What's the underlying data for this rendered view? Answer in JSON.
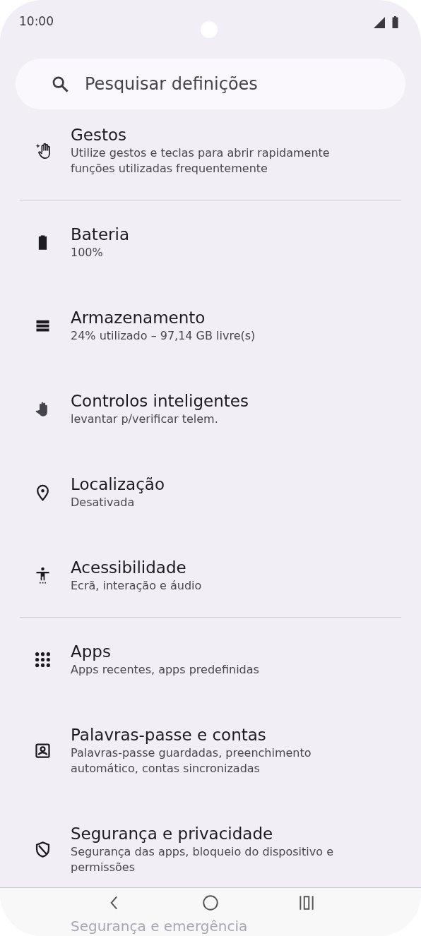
{
  "status_bar": {
    "time": "10:00"
  },
  "search": {
    "placeholder": "Pesquisar definições"
  },
  "groups": [
    {
      "items": [
        {
          "title": "Gestos",
          "subtitle": "Utilize gestos e teclas para abrir rapidamente funções utilizadas frequentemente"
        }
      ]
    },
    {
      "items": [
        {
          "title": "Bateria",
          "subtitle": "100%"
        },
        {
          "title": "Armazenamento",
          "subtitle": "24% utilizado – 97,14 GB livre(s)"
        },
        {
          "title": "Controlos inteligentes",
          "subtitle": "levantar p/verificar telem."
        },
        {
          "title": "Localização",
          "subtitle": "Desativada"
        },
        {
          "title": "Acessibilidade",
          "subtitle": "Ecrã, interação e áudio"
        }
      ]
    },
    {
      "items": [
        {
          "title": "Apps",
          "subtitle": "Apps recentes, apps predefinidas"
        },
        {
          "title": "Palavras-passe e contas",
          "subtitle": "Palavras-passe guardadas, preenchimento automático, contas sincronizadas"
        },
        {
          "title": "Segurança e privacidade",
          "subtitle": "Segurança das apps, bloqueio do dispositivo e permissões"
        },
        {
          "title": "Segurança e emergência",
          "faded": true
        }
      ]
    }
  ]
}
